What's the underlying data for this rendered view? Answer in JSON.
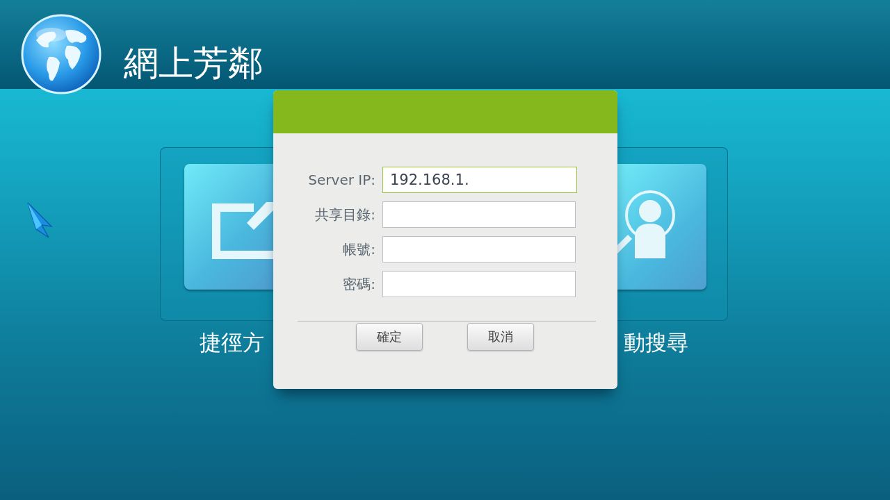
{
  "app": {
    "title": "網上芳鄰"
  },
  "shortcuts": [
    {
      "label": "捷徑方",
      "kind": "shortcut"
    },
    {
      "label": "動搜尋",
      "kind": "search"
    }
  ],
  "dialog": {
    "fields": [
      {
        "label": "Server IP:",
        "value": "192.168.1.",
        "focused": true
      },
      {
        "label": "共享目錄:",
        "focused": false
      },
      {
        "label": "帳號:",
        "focused": false
      },
      {
        "label": "密碼:",
        "focused": false
      }
    ],
    "buttons": [
      "確定",
      "取消"
    ]
  }
}
